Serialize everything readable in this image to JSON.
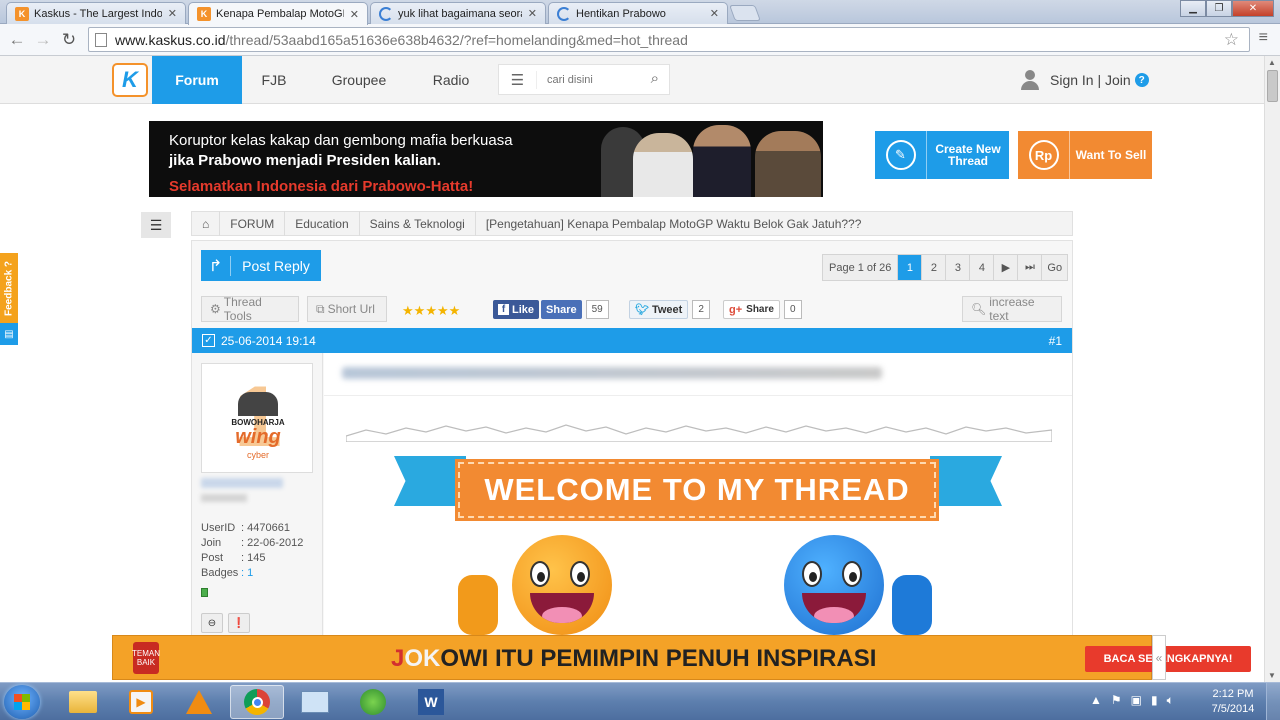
{
  "browser": {
    "tabs": [
      {
        "title": "Kaskus - The Largest Indo",
        "active": false,
        "favicon": "kaskus-favicon"
      },
      {
        "title": "Kenapa Pembalap MotoGP",
        "active": true,
        "favicon": "kaskus-favicon"
      },
      {
        "title": "yuk lihat bagaimana seora",
        "active": false,
        "favicon": "loading-spinner"
      },
      {
        "title": "Hentikan Prabowo",
        "active": false,
        "favicon": "loading-spinner"
      }
    ],
    "url_host": "www.kaskus.co.id",
    "url_path": "/thread/53aabd165a51636e638b4632/?ref=homelanding&med=hot_thread"
  },
  "header": {
    "logo": "K",
    "nav": [
      "Forum",
      "FJB",
      "Groupee",
      "Radio"
    ],
    "search_placeholder": "cari disini",
    "signin": "Sign In | Join",
    "help": "?"
  },
  "ad_banner": {
    "line1": "Koruptor kelas kakap dan gembong mafia berkuasa",
    "line2": "jika Prabowo menjadi Presiden kalian.",
    "line3": "Selamatkan Indonesia dari Prabowo-Hatta!"
  },
  "cta": {
    "create_thread": "Create New Thread",
    "want_to_sell": "Want To Sell",
    "rp": "Rp"
  },
  "feedback": "Feedback ?",
  "breadcrumb": [
    "FORUM",
    "Education",
    "Sains & Teknologi",
    "[Pengetahuan] Kenapa Pembalap MotoGP Waktu Belok Gak Jatuh???"
  ],
  "thread": {
    "post_reply": "Post Reply",
    "page_label": "Page 1 of 26",
    "pages": [
      "1",
      "2",
      "3",
      "4"
    ],
    "go": "Go",
    "thread_tools": "Thread Tools",
    "short_url": "Short Url",
    "rating": 5,
    "fb_like": "Like",
    "fb_share": "Share",
    "fb_count": "59",
    "tweet": "Tweet",
    "tweet_count": "2",
    "gplus": "Share",
    "gplus_count": "0",
    "increase_text": "increase text"
  },
  "post": {
    "date": "25-06-2014 19:14",
    "number": "#1",
    "welcome": "WELCOME TO MY THREAD",
    "avatar_text": "BOWOHARJA",
    "avatar_sub": "wing",
    "avatar_sub2": "cyber",
    "user": {
      "userid_label": "UserID",
      "userid": ": 4470661",
      "join_label": "Join",
      "join": ": 22-06-2012",
      "post_label": "Post",
      "post": ": 145",
      "badges_label": "Badges",
      "badges": ": 1"
    }
  },
  "bottom_ad": {
    "logo": "TEMAN BAIK",
    "headline_a": "J",
    "headline_b": "OK",
    "headline_c": "OWI ITU PEMIMPIN PENUH INSPIRASI",
    "button": "BACA SELENGKAPNYA!"
  },
  "taskbar": {
    "time": "2:12 PM",
    "date": "7/5/2014"
  },
  "colors": {
    "kaskus_blue": "#1e9ce8",
    "kaskus_orange": "#f28a32"
  }
}
